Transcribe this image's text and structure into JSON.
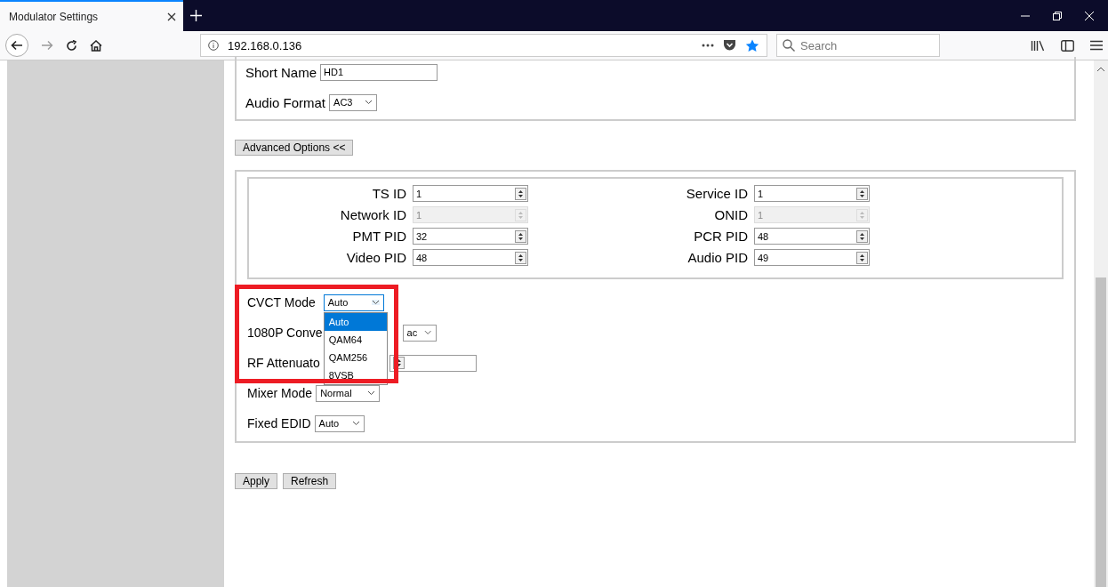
{
  "browser": {
    "tab": {
      "title": "Modulator Settings"
    },
    "url": "192.168.0.136",
    "search": {
      "placeholder": "Search"
    }
  },
  "basic": [
    {
      "label": "Short Name",
      "kind": "text",
      "value": "HD1"
    },
    {
      "label": "Audio Format",
      "kind": "select",
      "value": "AC3"
    }
  ],
  "advanced_button": "Advanced Options <<",
  "ids": [
    {
      "label": "TS ID",
      "value": "1",
      "disabled": false
    },
    {
      "label": "Service ID",
      "value": "1",
      "disabled": false
    },
    {
      "label": "Network ID",
      "value": "1",
      "disabled": true
    },
    {
      "label": "ONID",
      "value": "1",
      "disabled": true
    },
    {
      "label": "PMT PID",
      "value": "32",
      "disabled": false
    },
    {
      "label": "PCR PID",
      "value": "48",
      "disabled": false
    },
    {
      "label": "Video PID",
      "value": "48",
      "disabled": false
    },
    {
      "label": "Audio PID",
      "value": "49",
      "disabled": false
    }
  ],
  "advanced": [
    {
      "label": "CVCT Mode",
      "kind": "select",
      "value": "Auto",
      "expanded": true
    },
    {
      "label": "1080P Conve",
      "kind": "select",
      "value": "ac"
    },
    {
      "label": "RF Attenuato",
      "kind": "spin"
    },
    {
      "label": "Mixer Mode",
      "kind": "select",
      "value": "Normal"
    },
    {
      "label": "Fixed EDID",
      "kind": "select",
      "value": "Auto"
    }
  ],
  "dropdown": [
    {
      "label": "Auto",
      "selected": true
    },
    {
      "label": "QAM64",
      "selected": false
    },
    {
      "label": "QAM256",
      "selected": false
    },
    {
      "label": "8VSB",
      "selected": false
    }
  ],
  "buttons": [
    "Apply",
    "Refresh"
  ]
}
